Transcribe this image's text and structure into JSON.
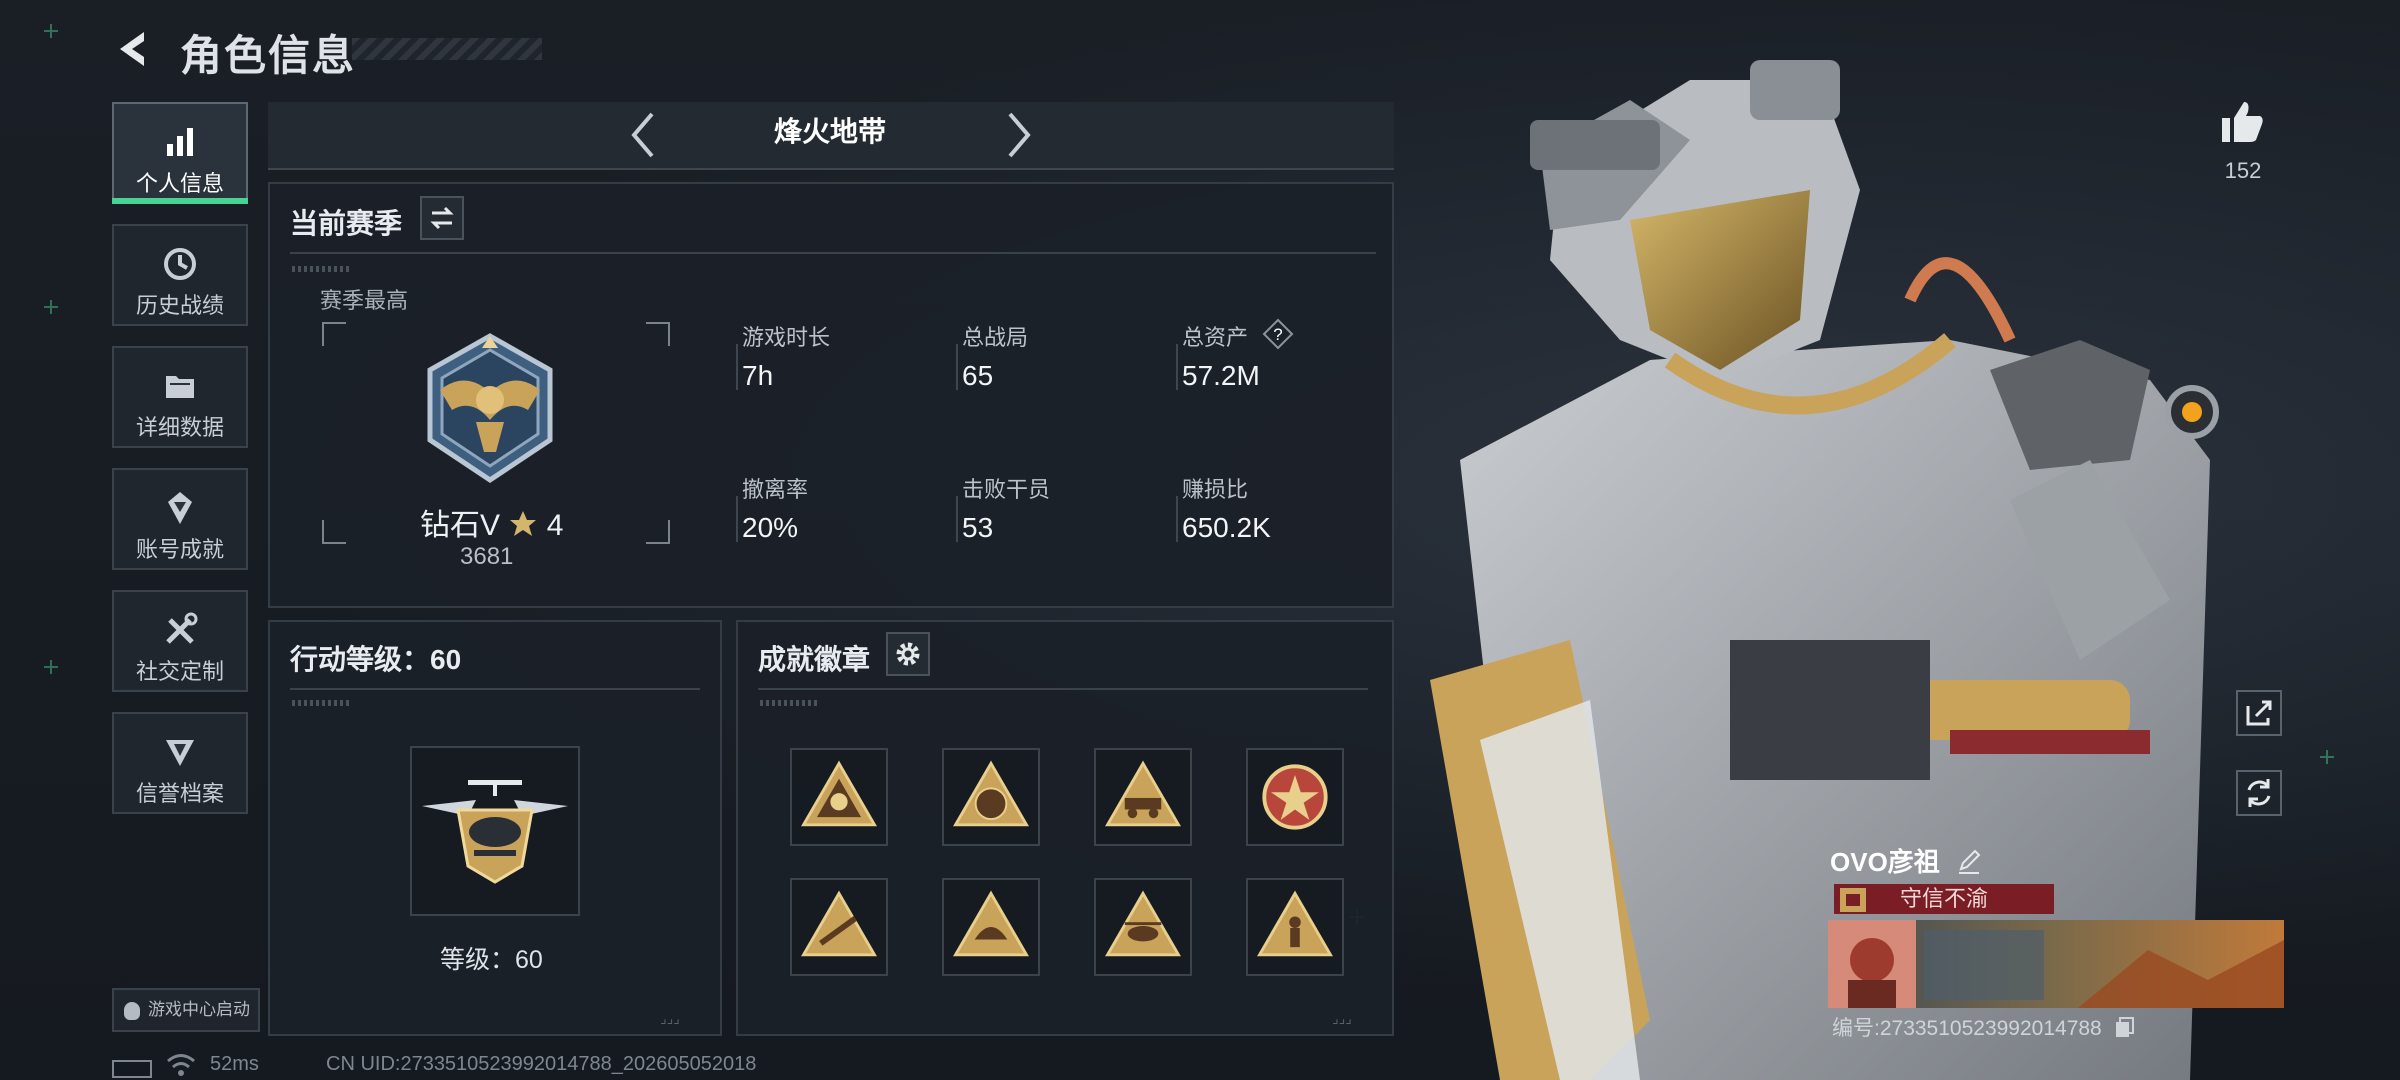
{
  "header": {
    "title": "角色信息"
  },
  "sidebar": {
    "items": [
      {
        "label": "个人信息",
        "icon": "bar-chart-icon",
        "active": true
      },
      {
        "label": "历史战绩",
        "icon": "history-icon",
        "active": false
      },
      {
        "label": "详细数据",
        "icon": "folder-icon",
        "active": false
      },
      {
        "label": "账号成就",
        "icon": "achievement-icon",
        "active": false
      },
      {
        "label": "社交定制",
        "icon": "tools-icon",
        "active": false
      },
      {
        "label": "信誉档案",
        "icon": "reputation-icon",
        "active": false
      }
    ],
    "game_center": "游戏中心启动"
  },
  "mode": {
    "name": "烽火地带"
  },
  "season": {
    "title": "当前赛季",
    "best_label": "赛季最高",
    "rank_name": "钻石V",
    "rank_stars": "4",
    "rank_score": "3681",
    "stats": [
      {
        "label": "游戏时长",
        "value": "7h"
      },
      {
        "label": "总战局",
        "value": "65"
      },
      {
        "label": "总资产",
        "value": "57.2M",
        "help": "?"
      },
      {
        "label": "撤离率",
        "value": "20%"
      },
      {
        "label": "击败干员",
        "value": "53"
      },
      {
        "label": "赚损比",
        "value": "650.2K"
      }
    ]
  },
  "action_level": {
    "title": "行动等级：60",
    "level_label": "等级：60"
  },
  "achievements": {
    "title": "成就徽章",
    "badges": [
      "badge-1",
      "badge-2",
      "badge-3",
      "badge-4",
      "badge-5",
      "badge-6",
      "badge-7",
      "badge-8"
    ]
  },
  "status_bar": {
    "ping": "52ms",
    "uid": "CN UID:2733510523992014788_202605052018"
  },
  "profile": {
    "likes": "152",
    "name": "OVO彦祖",
    "tag": "守信不渝",
    "id": "编号:2733510523992014788"
  },
  "colors": {
    "accent": "#47d392",
    "tag_bg": "#7a1d24",
    "gold": "#c9a35a"
  }
}
